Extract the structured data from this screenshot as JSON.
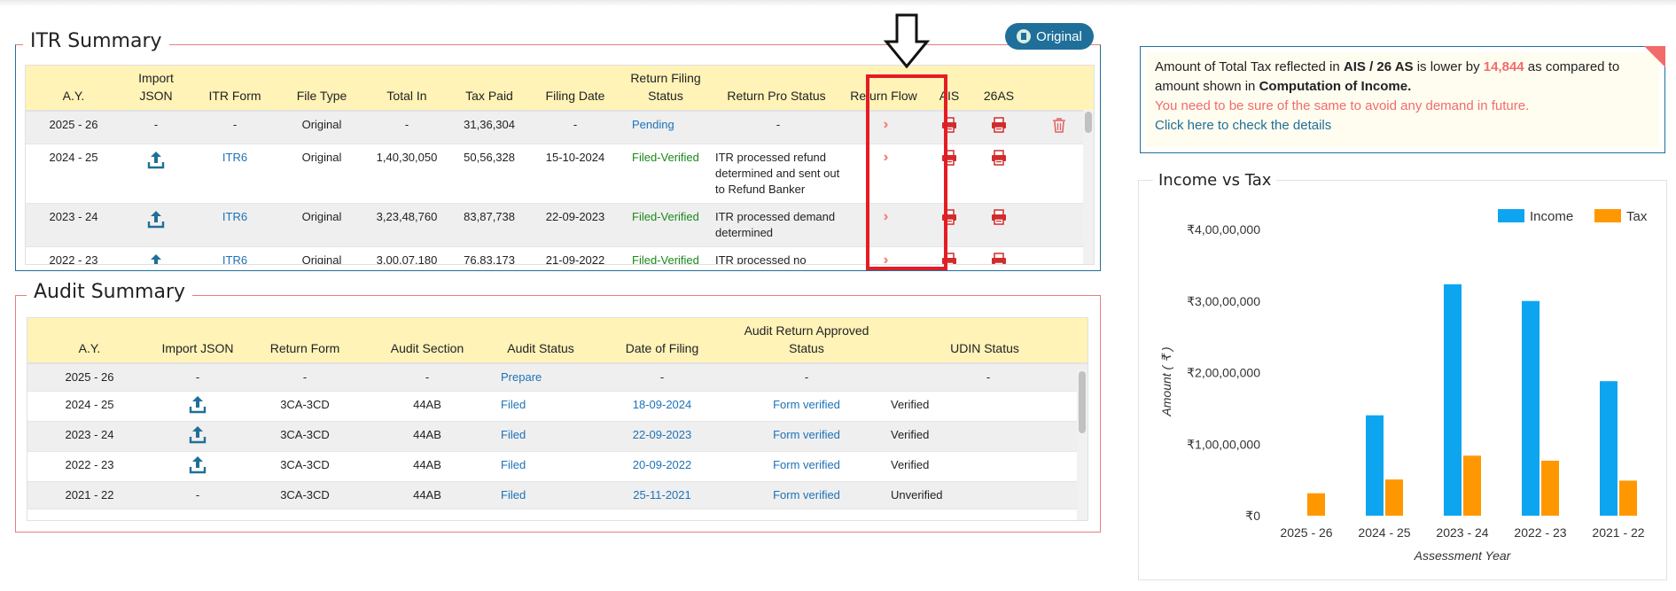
{
  "itr_summary": {
    "title": "ITR Summary",
    "original_pill": "Original",
    "headers": [
      "A.Y.",
      "Import JSON",
      "ITR Form",
      "File Type",
      "Total In",
      "Tax Paid",
      "Filing Date",
      "Return Filing Status",
      "Return Pro Status",
      "Return Flow",
      "AIS",
      "26AS"
    ],
    "rows": [
      {
        "ay": "2025 - 26",
        "import": "-",
        "form": "-",
        "file_type": "Original",
        "total_in": "-",
        "tax_paid": "31,36,304",
        "filing_date": "-",
        "filing_status": "Pending",
        "pro_status": "-",
        "status_color": "blue",
        "has_upload": false,
        "has_delete": true
      },
      {
        "ay": "2024 - 25",
        "import": "",
        "form": "ITR6",
        "file_type": "Original",
        "total_in": "1,40,30,050",
        "tax_paid": "50,56,328",
        "filing_date": "15-10-2024",
        "filing_status": "Filed-Verified",
        "pro_status": "ITR processed refund determined and sent out to Refund Banker",
        "status_color": "green",
        "has_upload": true,
        "has_delete": false
      },
      {
        "ay": "2023 - 24",
        "import": "",
        "form": "ITR6",
        "file_type": "Original",
        "total_in": "3,23,48,760",
        "tax_paid": "83,87,738",
        "filing_date": "22-09-2023",
        "filing_status": "Filed-Verified",
        "pro_status": "ITR processed demand determined",
        "status_color": "green",
        "has_upload": true,
        "has_delete": false
      },
      {
        "ay": "2022 - 23",
        "import": "",
        "form": "ITR6",
        "file_type": "Original",
        "total_in": "3,00,07,180",
        "tax_paid": "76,83,173",
        "filing_date": "21-09-2022",
        "filing_status": "Filed-Verified",
        "pro_status": "ITR processed no demand",
        "status_color": "green",
        "has_upload": true,
        "has_delete": false
      }
    ]
  },
  "audit_summary": {
    "title": "Audit Summary",
    "headers": [
      "A.Y.",
      "Import JSON",
      "Return Form",
      "Audit Section",
      "Audit Status",
      "Date of Filing",
      "Audit Return Approved Status",
      "UDIN Status"
    ],
    "rows": [
      {
        "ay": "2025 - 26",
        "import": "-",
        "form": "-",
        "section": "-",
        "status": "Prepare",
        "date": "-",
        "approved": "-",
        "udin": "-",
        "has_upload": false
      },
      {
        "ay": "2024 - 25",
        "import": "",
        "form": "3CA-3CD",
        "section": "44AB",
        "status": "Filed",
        "date": "18-09-2024",
        "approved": "Form verified",
        "udin": "Verified",
        "has_upload": true
      },
      {
        "ay": "2023 - 24",
        "import": "",
        "form": "3CA-3CD",
        "section": "44AB",
        "status": "Filed",
        "date": "22-09-2023",
        "approved": "Form verified",
        "udin": "Verified",
        "has_upload": true
      },
      {
        "ay": "2022 - 23",
        "import": "",
        "form": "3CA-3CD",
        "section": "44AB",
        "status": "Filed",
        "date": "20-09-2022",
        "approved": "Form verified",
        "udin": "Verified",
        "has_upload": true
      },
      {
        "ay": "2021 - 22",
        "import": "-",
        "form": "3CA-3CD",
        "section": "44AB",
        "status": "Filed",
        "date": "25-11-2021",
        "approved": "Form verified",
        "udin": "Unverified",
        "has_upload": false
      }
    ]
  },
  "notice": {
    "line1_a": "Amount of Total Tax reflected in ",
    "line1_b": "AIS / 26 AS",
    "line1_c": " is lower by ",
    "line1_amount": "14,844",
    "line1_d": " as compared to",
    "line2_a": "amount shown in ",
    "line2_b": "Computation of Income.",
    "warning": "You need to be sure of the same to avoid any demand in future.",
    "link": "Click here to check the details"
  },
  "chart_data": {
    "type": "bar",
    "title": "Income vs Tax",
    "xlabel": "Assessment Year",
    "ylabel": "Amount ( ₹ )",
    "categories": [
      "2025 - 26",
      "2024 - 25",
      "2023 - 24",
      "2022 - 23",
      "2021 - 22"
    ],
    "series": [
      {
        "name": "Income",
        "color": "#0ea5f0",
        "values": [
          0,
          14030050,
          32348760,
          30007180,
          18800000
        ]
      },
      {
        "name": "Tax",
        "color": "#ff9800",
        "values": [
          3136304,
          5056328,
          8387738,
          7683173,
          4900000
        ]
      }
    ],
    "yticks": [
      "₹0",
      "₹1,00,00,000",
      "₹2,00,00,000",
      "₹3,00,00,000",
      "₹4,00,00,000"
    ],
    "ylim": [
      0,
      40000000
    ],
    "legend": "top-right"
  }
}
